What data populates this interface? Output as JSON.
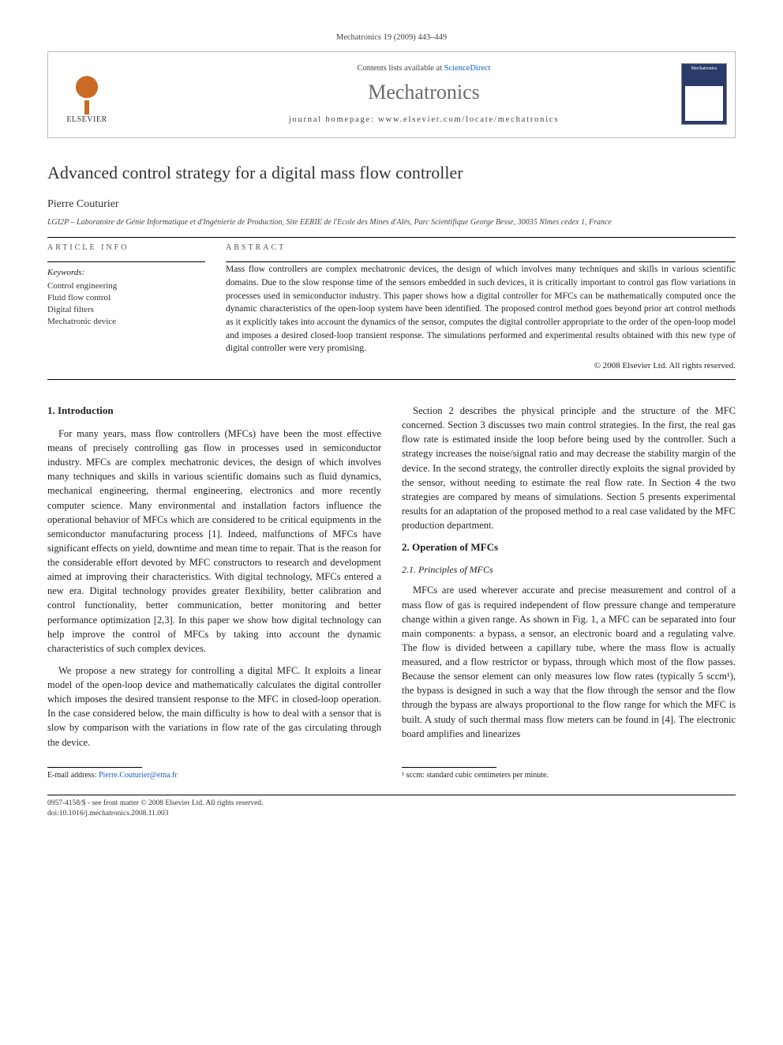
{
  "header": {
    "citation": "Mechatronics 19 (2009) 443–449",
    "contents_prefix": "Contents lists available at ",
    "contents_link": "ScienceDirect",
    "journal": "Mechatronics",
    "homepage_label": "journal homepage: www.elsevier.com/locate/mechatronics",
    "publisher": "ELSEVIER",
    "cover_label": "Mechatronics"
  },
  "article": {
    "title": "Advanced control strategy for a digital mass flow controller",
    "author": "Pierre Couturier",
    "affiliation": "LGI2P – Laboratoire de Génie Informatique et d'Ingénierie de Production, Site EERIE de l'Ecole des Mines d'Alès, Parc Scientifique George Besse, 30035 Nîmes cedex 1, France"
  },
  "info": {
    "label": "ARTICLE INFO",
    "keywords_head": "Keywords:",
    "keywords": [
      "Control engineering",
      "Fluid flow control",
      "Digital filters",
      "Mechatronic device"
    ]
  },
  "abstract": {
    "label": "ABSTRACT",
    "text": "Mass flow controllers are complex mechatronic devices, the design of which involves many techniques and skills in various scientific domains. Due to the slow response time of the sensors embedded in such devices, it is critically important to control gas flow variations in processes used in semiconductor industry. This paper shows how a digital controller for MFCs can be mathematically computed once the dynamic characteristics of the open-loop system have been identified. The proposed control method goes beyond prior art control methods as it explicitly takes into account the dynamics of the sensor, computes the digital controller appropriate to the order of the open-loop model and imposes a desired closed-loop transient response. The simulations performed and experimental results obtained with this new type of digital controller were very promising.",
    "copyright": "© 2008 Elsevier Ltd. All rights reserved."
  },
  "body": {
    "s1_head": "1. Introduction",
    "s1_p1": "For many years, mass flow controllers (MFCs) have been the most effective means of precisely controlling gas flow in processes used in semiconductor industry. MFCs are complex mechatronic devices, the design of which involves many techniques and skills in various scientific domains such as fluid dynamics, mechanical engineering, thermal engineering, electronics and more recently computer science. Many environmental and installation factors influence the operational behavior of MFCs which are considered to be critical equipments in the semiconductor manufacturing process [1]. Indeed, malfunctions of MFCs have significant effects on yield, downtime and mean time to repair. That is the reason for the considerable effort devoted by MFC constructors to research and development aimed at improving their characteristics. With digital technology, MFCs entered a new era. Digital technology provides greater flexibility, better calibration and control functionality, better communication, better monitoring and better performance optimization [2,3]. In this paper we show how digital technology can help improve the control of MFCs by taking into account the dynamic characteristics of such complex devices.",
    "s1_p2": "We propose a new strategy for controlling a digital MFC. It exploits a linear model of the open-loop device and mathematically calculates the digital controller which imposes the desired transient response to the MFC in closed-loop operation. In the case considered below, the main difficulty is how to deal with a sensor that is slow by comparison with the variations in flow rate of the gas circulating through the device.",
    "s1_p3": "Section 2 describes the physical principle and the structure of the MFC concerned. Section 3 discusses two main control strategies. In the first, the real gas flow rate is estimated inside the loop before being used by the controller. Such a strategy increases the noise/signal ratio and may decrease the stability margin of the device. In the second strategy, the controller directly exploits the signal provided by the sensor, without needing to estimate the real flow rate. In Section 4 the two strategies are compared by means of simulations. Section 5 presents experimental results for an adaptation of the proposed method to a real case validated by the MFC production department.",
    "s2_head": "2. Operation of MFCs",
    "s2_1_head": "2.1. Principles of MFCs",
    "s2_1_p1": "MFCs are used wherever accurate and precise measurement and control of a mass flow of gas is required independent of flow pressure change and temperature change within a given range. As shown in Fig. 1, a MFC can be separated into four main components: a bypass, a sensor, an electronic board and a regulating valve. The flow is divided between a capillary tube, where the mass flow is actually measured, and a flow restrictor or bypass, through which most of the flow passes. Because the sensor element can only measures low flow rates (typically 5 sccm¹), the bypass is designed in such a way that the flow through the sensor and the flow through the bypass are always proportional to the flow range for which the MFC is built. A study of such thermal mass flow meters can be found in [4]. The electronic board amplifies and linearizes"
  },
  "footnotes": {
    "email_label": "E-mail address: ",
    "email": "Pierre.Couturier@ema.fr",
    "fn1": "¹ sccm: standard cubic centimeters per minute.",
    "issn": "0957-4158/$ - see front matter © 2008 Elsevier Ltd. All rights reserved.",
    "doi": "doi:10.1016/j.mechatronics.2008.11.003"
  }
}
